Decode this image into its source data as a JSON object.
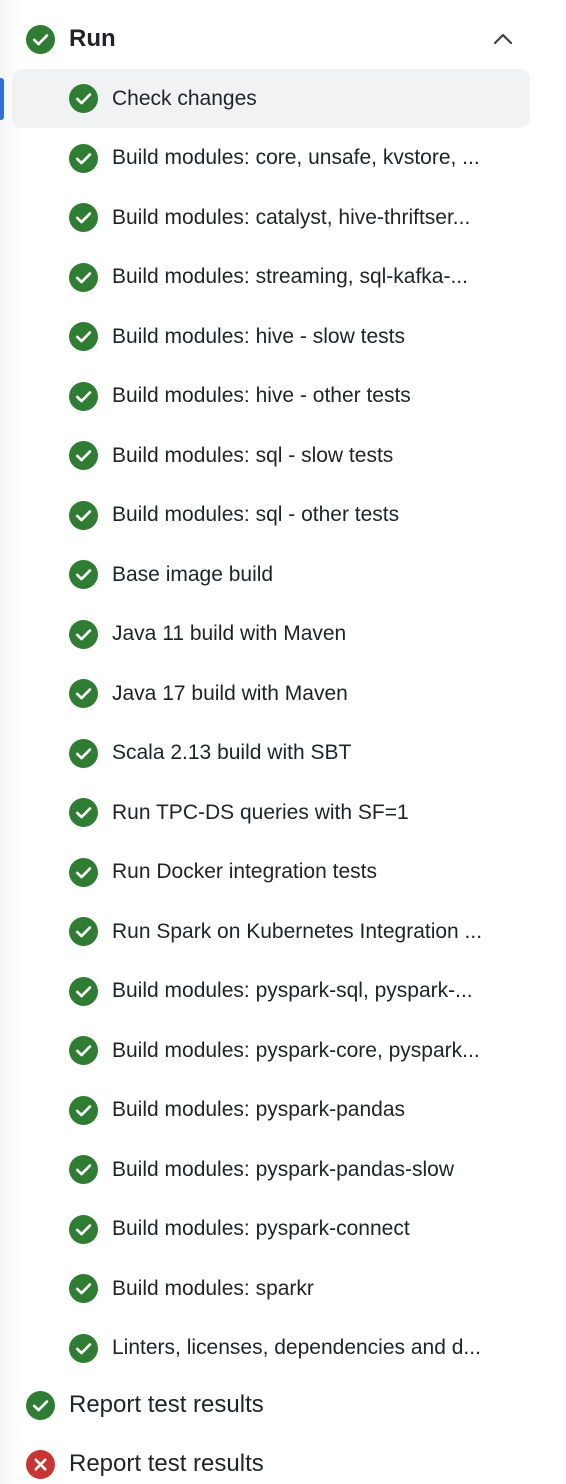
{
  "colors": {
    "success": "#2f7d32",
    "failure": "#c93434",
    "active_indicator": "#2f6fde",
    "selected_row_bg": "#f1f2f4"
  },
  "group": {
    "label": "Run",
    "status": "success",
    "expanded": true,
    "chevron_icon": "chevron-up-icon"
  },
  "jobs": [
    {
      "label": "Check changes",
      "status": "success",
      "selected": true
    },
    {
      "label": "Build modules: core, unsafe, kvstore, ...",
      "status": "success"
    },
    {
      "label": "Build modules: catalyst, hive-thriftser...",
      "status": "success"
    },
    {
      "label": "Build modules: streaming, sql-kafka-...",
      "status": "success"
    },
    {
      "label": "Build modules: hive - slow tests",
      "status": "success"
    },
    {
      "label": "Build modules: hive - other tests",
      "status": "success"
    },
    {
      "label": "Build modules: sql - slow tests",
      "status": "success"
    },
    {
      "label": "Build modules: sql - other tests",
      "status": "success"
    },
    {
      "label": "Base image build",
      "status": "success"
    },
    {
      "label": "Java 11 build with Maven",
      "status": "success"
    },
    {
      "label": "Java 17 build with Maven",
      "status": "success"
    },
    {
      "label": "Scala 2.13 build with SBT",
      "status": "success"
    },
    {
      "label": "Run TPC-DS queries with SF=1",
      "status": "success"
    },
    {
      "label": "Run Docker integration tests",
      "status": "success"
    },
    {
      "label": "Run Spark on Kubernetes Integration ...",
      "status": "success"
    },
    {
      "label": "Build modules: pyspark-sql, pyspark-...",
      "status": "success"
    },
    {
      "label": "Build modules: pyspark-core, pyspark...",
      "status": "success"
    },
    {
      "label": "Build modules: pyspark-pandas",
      "status": "success"
    },
    {
      "label": "Build modules: pyspark-pandas-slow",
      "status": "success"
    },
    {
      "label": "Build modules: pyspark-connect",
      "status": "success"
    },
    {
      "label": "Build modules: sparkr",
      "status": "success"
    },
    {
      "label": "Linters, licenses, dependencies and d...",
      "status": "success"
    }
  ],
  "after_jobs": [
    {
      "label": "Report test results",
      "status": "success"
    },
    {
      "label": "Report test results",
      "status": "failure"
    }
  ]
}
